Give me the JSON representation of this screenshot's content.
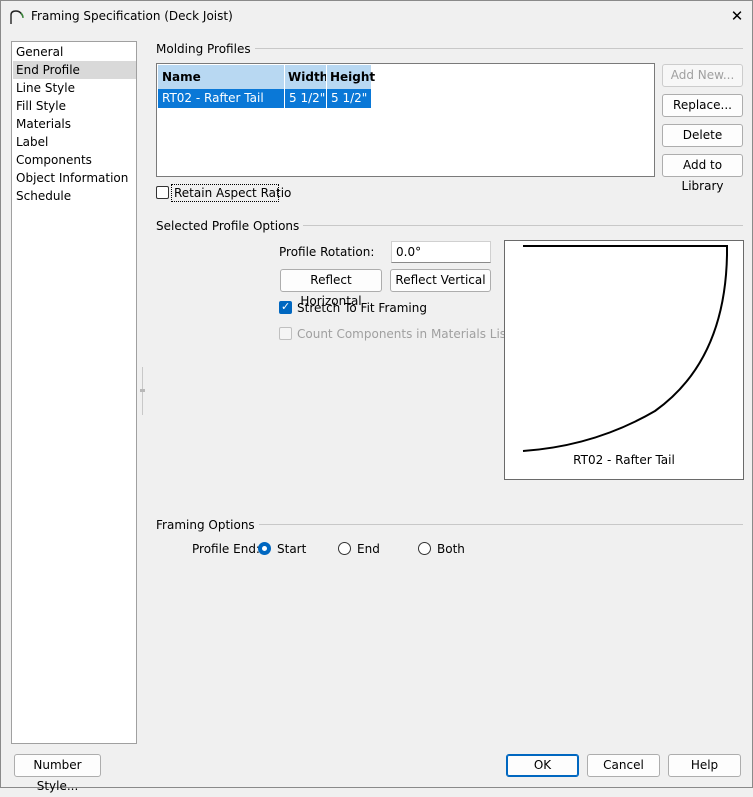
{
  "window": {
    "title": "Framing Specification (Deck Joist)",
    "close_glyph": "✕"
  },
  "nav": {
    "items": [
      {
        "label": "General"
      },
      {
        "label": "End Profile"
      },
      {
        "label": "Line Style"
      },
      {
        "label": "Fill Style"
      },
      {
        "label": "Materials"
      },
      {
        "label": "Label"
      },
      {
        "label": "Components"
      },
      {
        "label": "Object Information"
      },
      {
        "label": "Schedule"
      }
    ],
    "selected": "End Profile"
  },
  "molding_profiles": {
    "group_label": "Molding Profiles",
    "columns": [
      "Name",
      "Width",
      "Height"
    ],
    "rows": [
      {
        "name": "RT02 - Rafter Tail",
        "width": "5 1/2\"",
        "height": "5 1/2\""
      }
    ],
    "buttons": {
      "add_new": "Add New...",
      "replace": "Replace...",
      "delete": "Delete",
      "add_to_library": "Add to Library"
    },
    "retain_aspect_ratio": {
      "label": "Retain Aspect Ratio",
      "checked": false
    }
  },
  "selected_profile_options": {
    "group_label": "Selected Profile Options",
    "rotation_label": "Profile Rotation:",
    "rotation_value": "0.0°",
    "reflect_horizontal": "Reflect Horizontal",
    "reflect_vertical": "Reflect Vertical",
    "stretch_to_fit": {
      "label": "Stretch To Fit Framing",
      "checked": true
    },
    "count_components": {
      "label": "Count Components in Materials List",
      "checked": false,
      "enabled": false
    },
    "preview_caption": "RT02 - Rafter Tail"
  },
  "framing_options": {
    "group_label": "Framing Options",
    "profile_end_label": "Profile End:",
    "options": [
      "Start",
      "End",
      "Both"
    ],
    "selected": "Start"
  },
  "footer": {
    "number_style": "Number Style...",
    "ok": "OK",
    "cancel": "Cancel",
    "help": "Help"
  },
  "colors": {
    "accent": "#0067c0",
    "selection": "#0a78d7",
    "header": "#b8d8f2"
  }
}
